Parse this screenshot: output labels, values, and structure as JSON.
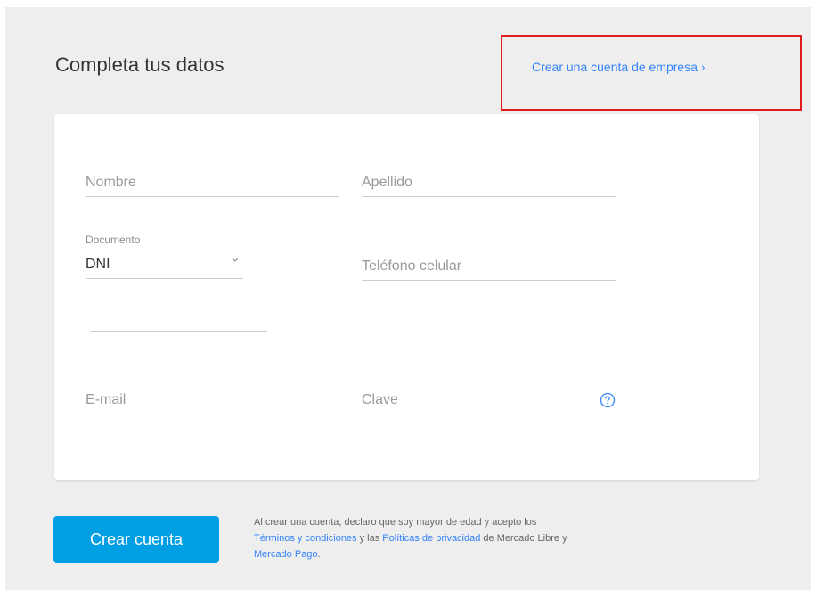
{
  "header": {
    "title": "Completa tus datos",
    "business_link": "Crear una cuenta de empresa ›"
  },
  "form": {
    "first_name": {
      "placeholder": "Nombre",
      "value": ""
    },
    "last_name": {
      "placeholder": "Apellido",
      "value": ""
    },
    "document": {
      "label": "Documento",
      "selected": "DNI",
      "number": {
        "placeholder": "",
        "value": ""
      }
    },
    "phone": {
      "placeholder": "Teléfono celular",
      "value": ""
    },
    "email": {
      "placeholder": "E-mail",
      "value": ""
    },
    "password": {
      "placeholder": "Clave",
      "value": ""
    },
    "help_icon": "help-circle-icon"
  },
  "submit": {
    "label": "Crear cuenta"
  },
  "legal": {
    "text_1": "Al crear una cuenta, declaro que soy mayor de edad y acepto los",
    "terms_link": "Términos y condiciones",
    "text_2": " y las ",
    "privacy_link": "Políticas de privacidad",
    "text_3": " de Mercado Libre y ",
    "mercadopago_link": "Mercado Pago",
    "text_4": "."
  },
  "colors": {
    "link": "#3483fa",
    "button": "#009ee3",
    "highlight_box": "#e01b1b",
    "background": "#eeeeee"
  }
}
